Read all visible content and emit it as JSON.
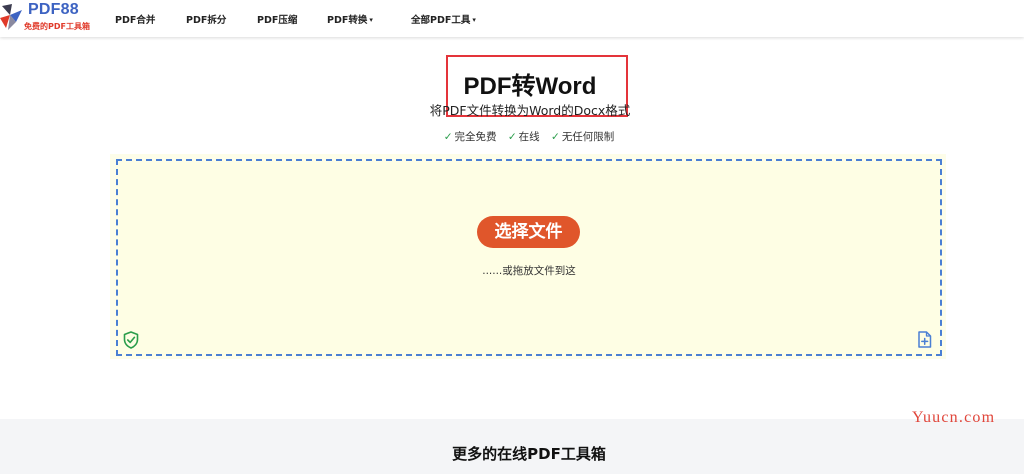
{
  "brand": {
    "name": "PDF88",
    "tagline": "免费的PDF工具箱",
    "colors": {
      "primary": "#3d63c2",
      "accent": "#e03a2a"
    }
  },
  "nav": {
    "items": [
      {
        "label": "PDF合并",
        "dropdown": false
      },
      {
        "label": "PDF拆分",
        "dropdown": false
      },
      {
        "label": "PDF压缩",
        "dropdown": false
      },
      {
        "label": "PDF转换",
        "dropdown": true
      },
      {
        "label": "全部PDF工具",
        "dropdown": true
      }
    ],
    "caret": "▾"
  },
  "hero": {
    "title": "PDF转Word",
    "subtitle": "将PDF文件转换为Word的Docx格式",
    "features": [
      "完全免费",
      "在线",
      "无任何限制"
    ],
    "check_glyph": "✓"
  },
  "upload": {
    "button_label": "选择文件",
    "button_color": "#e0562b",
    "hint": "......或拖放文件到这",
    "border_color": "#4a7fd4",
    "background": "#fefee4",
    "left_icon": "shield-check-icon",
    "right_icon": "add-file-icon"
  },
  "more": {
    "title": "更多的在线PDF工具箱"
  },
  "watermark": {
    "text": "Yuucn.com"
  }
}
